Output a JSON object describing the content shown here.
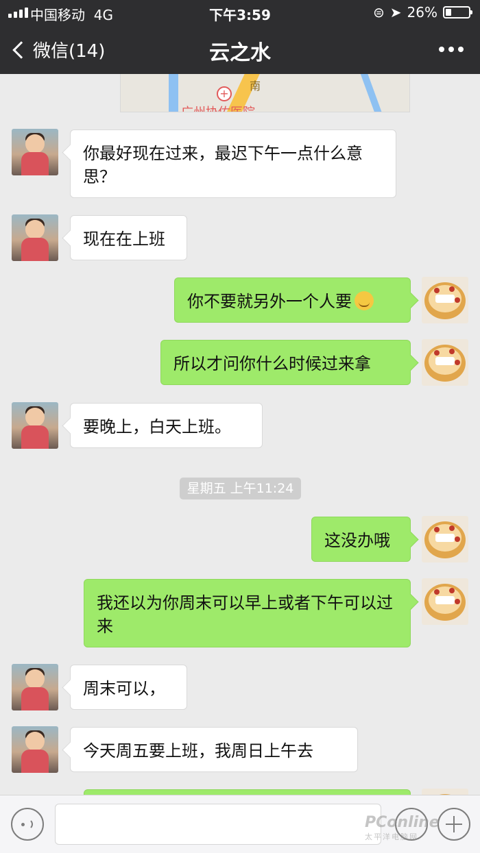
{
  "status_bar": {
    "carrier": "中国移动",
    "network": "4G",
    "time": "下午3:59",
    "battery": "26%",
    "battery_level": 0.26
  },
  "nav": {
    "back_label": "微信(14)",
    "title": "云之水"
  },
  "map_card": {
    "label": "广州协佑医院",
    "street": "南"
  },
  "messages": [
    {
      "side": "left",
      "text": "你最好现在过来，最迟下午一点什么意思？"
    },
    {
      "side": "left",
      "text": "现在在上班"
    },
    {
      "side": "right",
      "text": "你不要就另外一个人要",
      "emoji": "smirk-emoji"
    },
    {
      "side": "right",
      "text": "所以才问你什么时候过来拿"
    },
    {
      "side": "left",
      "text": "要晚上，白天上班。"
    },
    {
      "side": "right",
      "text": "这没办哦"
    },
    {
      "side": "right",
      "text": "我还以为你周末可以早上或者下午可以过来"
    },
    {
      "side": "left",
      "text": "周末可以，"
    },
    {
      "side": "left",
      "text": "今天周五要上班，我周日上午去"
    }
  ],
  "timestamp": "星期五 上午11:24",
  "watermark": {
    "brand": "PConline",
    "sub": "太平洋电脑网"
  },
  "colors": {
    "nav_bg": "#2e2e30",
    "chat_bg": "#ebebeb",
    "sent_bubble": "#9eea6a",
    "received_bubble": "#ffffff"
  }
}
